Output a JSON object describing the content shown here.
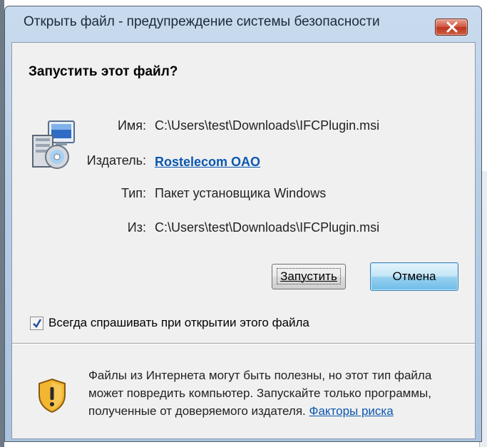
{
  "window": {
    "title": "Открыть файл - предупреждение системы безопасности"
  },
  "dialog": {
    "heading": "Запустить этот файл?",
    "fields": {
      "name": {
        "label": "Имя:",
        "value": "C:\\Users\\test\\Downloads\\IFCPlugin.msi"
      },
      "publisher": {
        "label": "Издатель:",
        "value": "Rostelecom OAO"
      },
      "type": {
        "label": "Тип:",
        "value": "Пакет установщика Windows"
      },
      "from": {
        "label": "Из:",
        "value": "C:\\Users\\test\\Downloads\\IFCPlugin.msi"
      }
    },
    "buttons": {
      "run": "Запустить",
      "cancel": "Отмена"
    },
    "checkbox": {
      "label": "Всегда спрашивать при открытии этого файла",
      "checked": true
    },
    "warning": {
      "text": "Файлы из Интернета могут быть полезны, но этот тип файла может повредить компьютер. Запускайте только программы, полученные от доверяемого издателя.",
      "link": "Факторы риска"
    }
  },
  "icons": {
    "close": "close-icon",
    "file": "installer-package-icon",
    "warning": "security-shield-warning-icon",
    "checkmark": "checkmark-icon"
  },
  "colors": {
    "link": "#0b57b0",
    "close_button": "#c9452e",
    "title_bar": "#b6cde6",
    "dialog_background": "#f0f0f0"
  }
}
